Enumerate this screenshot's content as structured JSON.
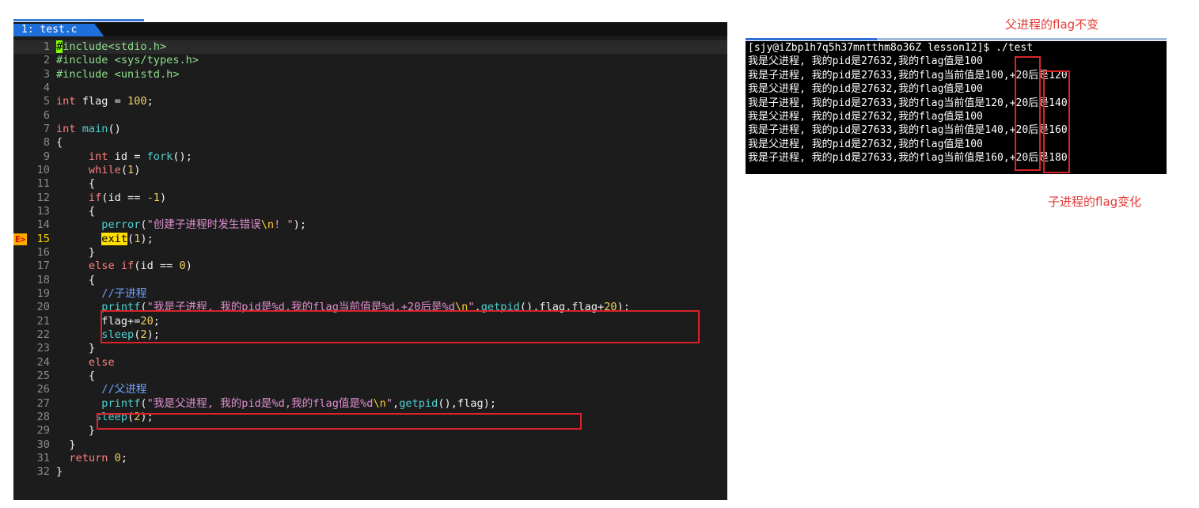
{
  "editor": {
    "tab_label": "1: test.c",
    "lines": [
      {
        "n": "1",
        "html": "<span class=\"cursor\">#</span><span class=\"pp\">include&lt;stdio.h&gt;</span>",
        "hl": true
      },
      {
        "n": "2",
        "html": "<span class=\"pp\">#include &lt;sys/types.h&gt;</span>"
      },
      {
        "n": "3",
        "html": "<span class=\"pp\">#include &lt;unistd.h&gt;</span>"
      },
      {
        "n": "4",
        "html": ""
      },
      {
        "n": "5",
        "html": "<span class=\"kw\">int</span> flag = <span class=\"num\">100</span>;"
      },
      {
        "n": "6",
        "html": ""
      },
      {
        "n": "7",
        "html": "<span class=\"kw\">int</span> <span class=\"fn\">main</span>()"
      },
      {
        "n": "8",
        "html": "{"
      },
      {
        "n": "9",
        "html": "     <span class=\"kw\">int</span> id = <span class=\"fn\">fork</span>();"
      },
      {
        "n": "10",
        "html": "     <span class=\"kw\">while</span>(<span class=\"num\">1</span>)"
      },
      {
        "n": "11",
        "html": "     {"
      },
      {
        "n": "12",
        "html": "     <span class=\"kw\">if</span>(id == <span class=\"num\">-1</span>)"
      },
      {
        "n": "13",
        "html": "     {"
      },
      {
        "n": "14",
        "html": "       <span class=\"fn\">perror</span>(<span class=\"str\">\"创建子进程时发生错误<span class=\"esc\">\\n</span>! \"</span>);"
      },
      {
        "n": "15",
        "html": "       <span class=\"exit-hl\">exit</span>(<span class=\"num\">1</span>);",
        "marker": "E>",
        "cur": true
      },
      {
        "n": "16",
        "html": "     }"
      },
      {
        "n": "17",
        "html": "     <span class=\"kw\">else if</span>(id == <span class=\"num\">0</span>)"
      },
      {
        "n": "18",
        "html": "     {"
      },
      {
        "n": "19",
        "html": "       <span class=\"cm\">//子进程</span>"
      },
      {
        "n": "20",
        "html": "       <span class=\"fn\">printf</span>(<span class=\"str\">\"我是子进程, 我的pid是%d,我的flag当前值是%d,+20后是%d<span class=\"esc\">\\n</span>\"</span>,<span class=\"fn\">getpid</span>(),flag,flag+<span class=\"num\">20</span>);"
      },
      {
        "n": "21",
        "html": "       flag+=<span class=\"num\">20</span>;"
      },
      {
        "n": "22",
        "html": "       <span class=\"fn\">sleep</span>(<span class=\"num\">2</span>);"
      },
      {
        "n": "23",
        "html": "     }"
      },
      {
        "n": "24",
        "html": "     <span class=\"kw\">else</span>"
      },
      {
        "n": "25",
        "html": "     {"
      },
      {
        "n": "26",
        "html": "       <span class=\"cm\">//父进程</span>"
      },
      {
        "n": "27",
        "html": "       <span class=\"fn\">printf</span>(<span class=\"str\">\"我是父进程, 我的pid是%d,我的flag值是%d<span class=\"esc\">\\n</span>\"</span>,<span class=\"fn\">getpid</span>(),flag);"
      },
      {
        "n": "28",
        "html": "      <span class=\"fn\">sleep</span>(<span class=\"num\">2</span>);"
      },
      {
        "n": "29",
        "html": "     }"
      },
      {
        "n": "30",
        "html": "  }"
      },
      {
        "n": "31",
        "html": "  <span class=\"kw\">return</span> <span class=\"num\">0</span>;"
      },
      {
        "n": "32",
        "html": "}"
      }
    ]
  },
  "terminal": {
    "lines": [
      "[sjy@iZbp1h7q5h37mntthm8o36Z lesson12]$ ./test",
      "我是父进程, 我的pid是27632,我的flag值是100",
      "我是子进程, 我的pid是27633,我的flag当前值是100,+20后是120",
      "我是父进程, 我的pid是27632,我的flag值是100",
      "我是子进程, 我的pid是27633,我的flag当前值是120,+20后是140",
      "我是父进程, 我的pid是27632,我的flag值是100",
      "我是子进程, 我的pid是27633,我的flag当前值是140,+20后是160",
      "我是父进程, 我的pid是27632,我的flag值是100",
      "我是子进程, 我的pid是27633,我的flag当前值是160,+20后是180"
    ]
  },
  "annotations": {
    "parent_note": "父进程的flag不变",
    "child_note": "子进程的flag变化"
  },
  "colors": {
    "accent_red": "#e53935",
    "tab_blue": "#1e6fd9",
    "editor_bg": "#1c1c1c",
    "terminal_bg": "#000000"
  }
}
